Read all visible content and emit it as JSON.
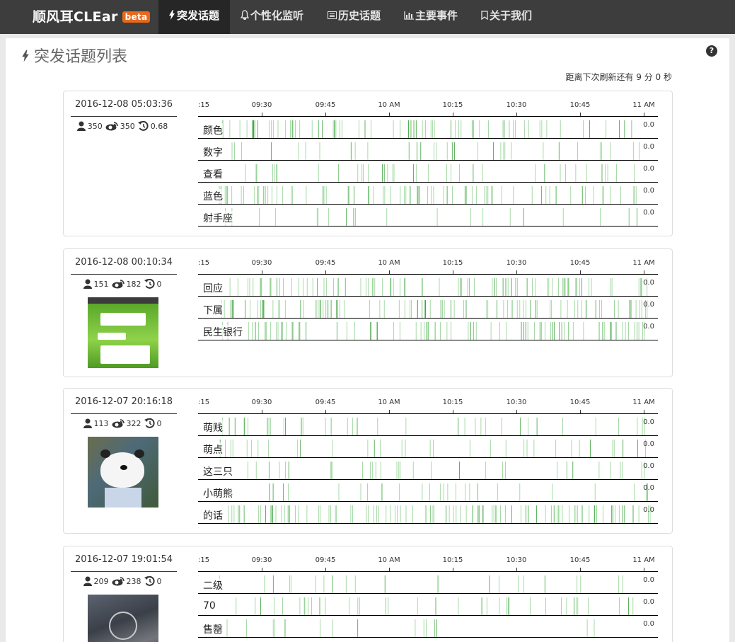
{
  "nav": {
    "brand": "顺风耳CLEar",
    "beta": "beta",
    "items": [
      {
        "label": "突发话题",
        "icon": "bolt-icon",
        "active": true
      },
      {
        "label": "个性化监听",
        "icon": "bell-icon",
        "active": false
      },
      {
        "label": "历史话题",
        "icon": "list-icon",
        "active": false
      },
      {
        "label": "主要事件",
        "icon": "bar-chart-icon",
        "active": false
      },
      {
        "label": "关于我们",
        "icon": "bookmark-icon",
        "active": false
      }
    ]
  },
  "page": {
    "title": "突发话题列表",
    "help": "?",
    "refresh_text": "距离下次刷新还有 9 分 0 秒"
  },
  "axis": {
    "first": ":15",
    "ticks": [
      "09:30",
      "09:45",
      "10 AM",
      "10:15",
      "10:30",
      "10:45",
      "11 AM"
    ]
  },
  "topics": [
    {
      "time": "2016-12-08 05:03:36",
      "users": "350",
      "views": "350",
      "score": "0.68",
      "thumb": null,
      "keywords": [
        {
          "word": "颜色",
          "value": "0.0",
          "density": 0.7
        },
        {
          "word": "数字",
          "value": "0.0",
          "density": 0.3
        },
        {
          "word": "查看",
          "value": "0.0",
          "density": 0.35
        },
        {
          "word": "蓝色",
          "value": "0.0",
          "density": 0.75
        },
        {
          "word": "射手座",
          "value": "0.0",
          "density": 0.2
        }
      ]
    },
    {
      "time": "2016-12-08 00:10:34",
      "users": "151",
      "views": "182",
      "score": "0",
      "thumb": "chat",
      "keywords": [
        {
          "word": "回应",
          "value": "0.0",
          "density": 0.8
        },
        {
          "word": "下属",
          "value": "0.0",
          "density": 0.85
        },
        {
          "word": "民生银行",
          "value": "0.0",
          "density": 0.85
        }
      ]
    },
    {
      "time": "2016-12-07 20:16:18",
      "users": "113",
      "views": "322",
      "score": "0",
      "thumb": "panda",
      "keywords": [
        {
          "word": "萌贱",
          "value": "0.0",
          "density": 0.35
        },
        {
          "word": "萌点",
          "value": "0.0",
          "density": 0.3
        },
        {
          "word": "这三只",
          "value": "0.0",
          "density": 0.3
        },
        {
          "word": "小萌熊",
          "value": "0.0",
          "density": 0.25
        },
        {
          "word": "的话",
          "value": "0.0",
          "density": 0.95
        }
      ]
    },
    {
      "time": "2016-12-07 19:01:54",
      "users": "209",
      "views": "238",
      "score": "0",
      "thumb": "photo",
      "keywords": [
        {
          "word": "二级",
          "value": "0.0",
          "density": 0.2
        },
        {
          "word": "70",
          "value": "0.0",
          "density": 0.35
        },
        {
          "word": "售罄",
          "value": "0.0",
          "density": 0.15
        }
      ]
    }
  ]
}
